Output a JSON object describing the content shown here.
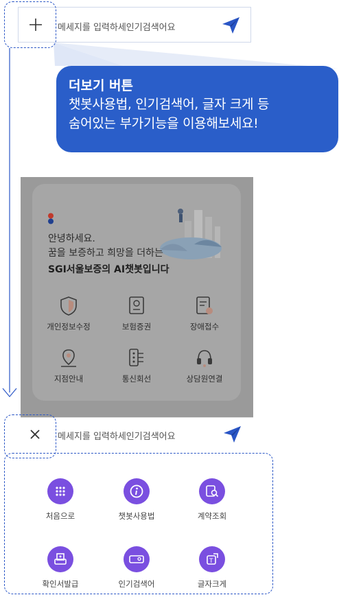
{
  "input": {
    "placeholder": "메세지를 입력하세인기검색어요"
  },
  "callout": {
    "title": "더보기 버튼",
    "line1": "챗봇사용법, 인기검색어, 글자 크게 등",
    "line2": "숨어있는 부가기능을 이용해보세요!"
  },
  "welcome": {
    "line1": "안녕하세요.",
    "line2": "꿈을 보증하고 희망을 더하는",
    "line3": "SGI서울보증의 AI챗봇입니다"
  },
  "menu": [
    {
      "label": "개인정보수정",
      "icon": "shield-icon"
    },
    {
      "label": "보험증권",
      "icon": "certificate-icon"
    },
    {
      "label": "장애접수",
      "icon": "report-icon"
    },
    {
      "label": "지점안내",
      "icon": "map-pin-icon"
    },
    {
      "label": "통신회선",
      "icon": "network-icon"
    },
    {
      "label": "상담원연결",
      "icon": "headset-icon"
    }
  ],
  "options": [
    {
      "label": "처음으로",
      "icon": "grid-icon"
    },
    {
      "label": "챗봇사용법",
      "icon": "info-icon"
    },
    {
      "label": "계약조회",
      "icon": "contract-search-icon"
    },
    {
      "label": "확인서발급",
      "icon": "printer-icon"
    },
    {
      "label": "인기검색어",
      "icon": "search-bar-icon"
    },
    {
      "label": "글자크게",
      "icon": "text-size-icon"
    }
  ],
  "colors": {
    "accent_blue": "#2a5ec9",
    "option_purple": "#7a4fe0",
    "overlay_gray": "#9a9a9a"
  }
}
